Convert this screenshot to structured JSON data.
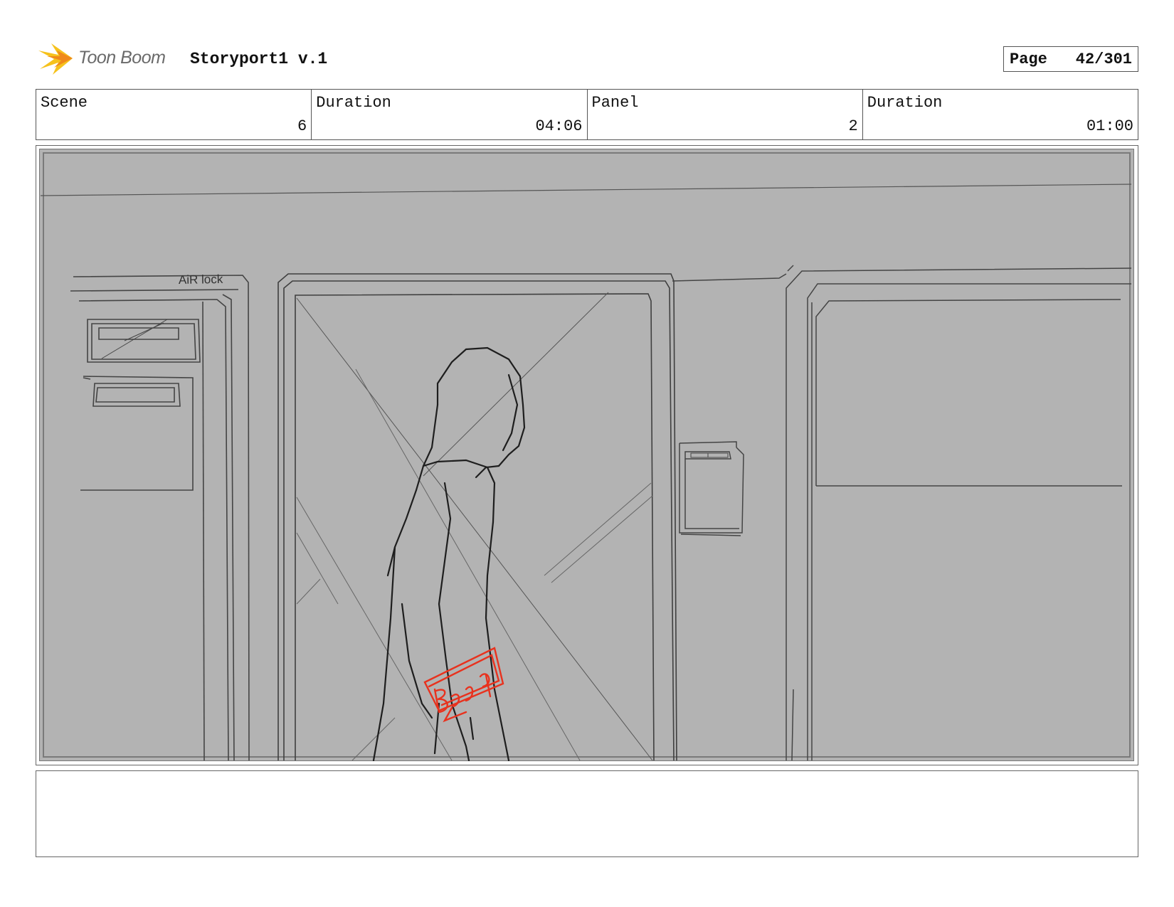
{
  "header": {
    "logo_text": "Toon Boom",
    "project_title": "Storyport1 v.1",
    "page_label": "Page",
    "page_number": "42/301"
  },
  "info": {
    "scene_label": "Scene",
    "scene_value": "6",
    "scene_duration_label": "Duration",
    "scene_duration_value": "04:06",
    "panel_label": "Panel",
    "panel_value": "2",
    "panel_duration_label": "Duration",
    "panel_duration_value": "01:00"
  },
  "sketch": {
    "airlock_sign": "AiR lock",
    "sound_effect": "BeeP",
    "background_color": "#b3b3b3",
    "effect_color": "#e8321e"
  },
  "notes": {
    "text": ""
  }
}
